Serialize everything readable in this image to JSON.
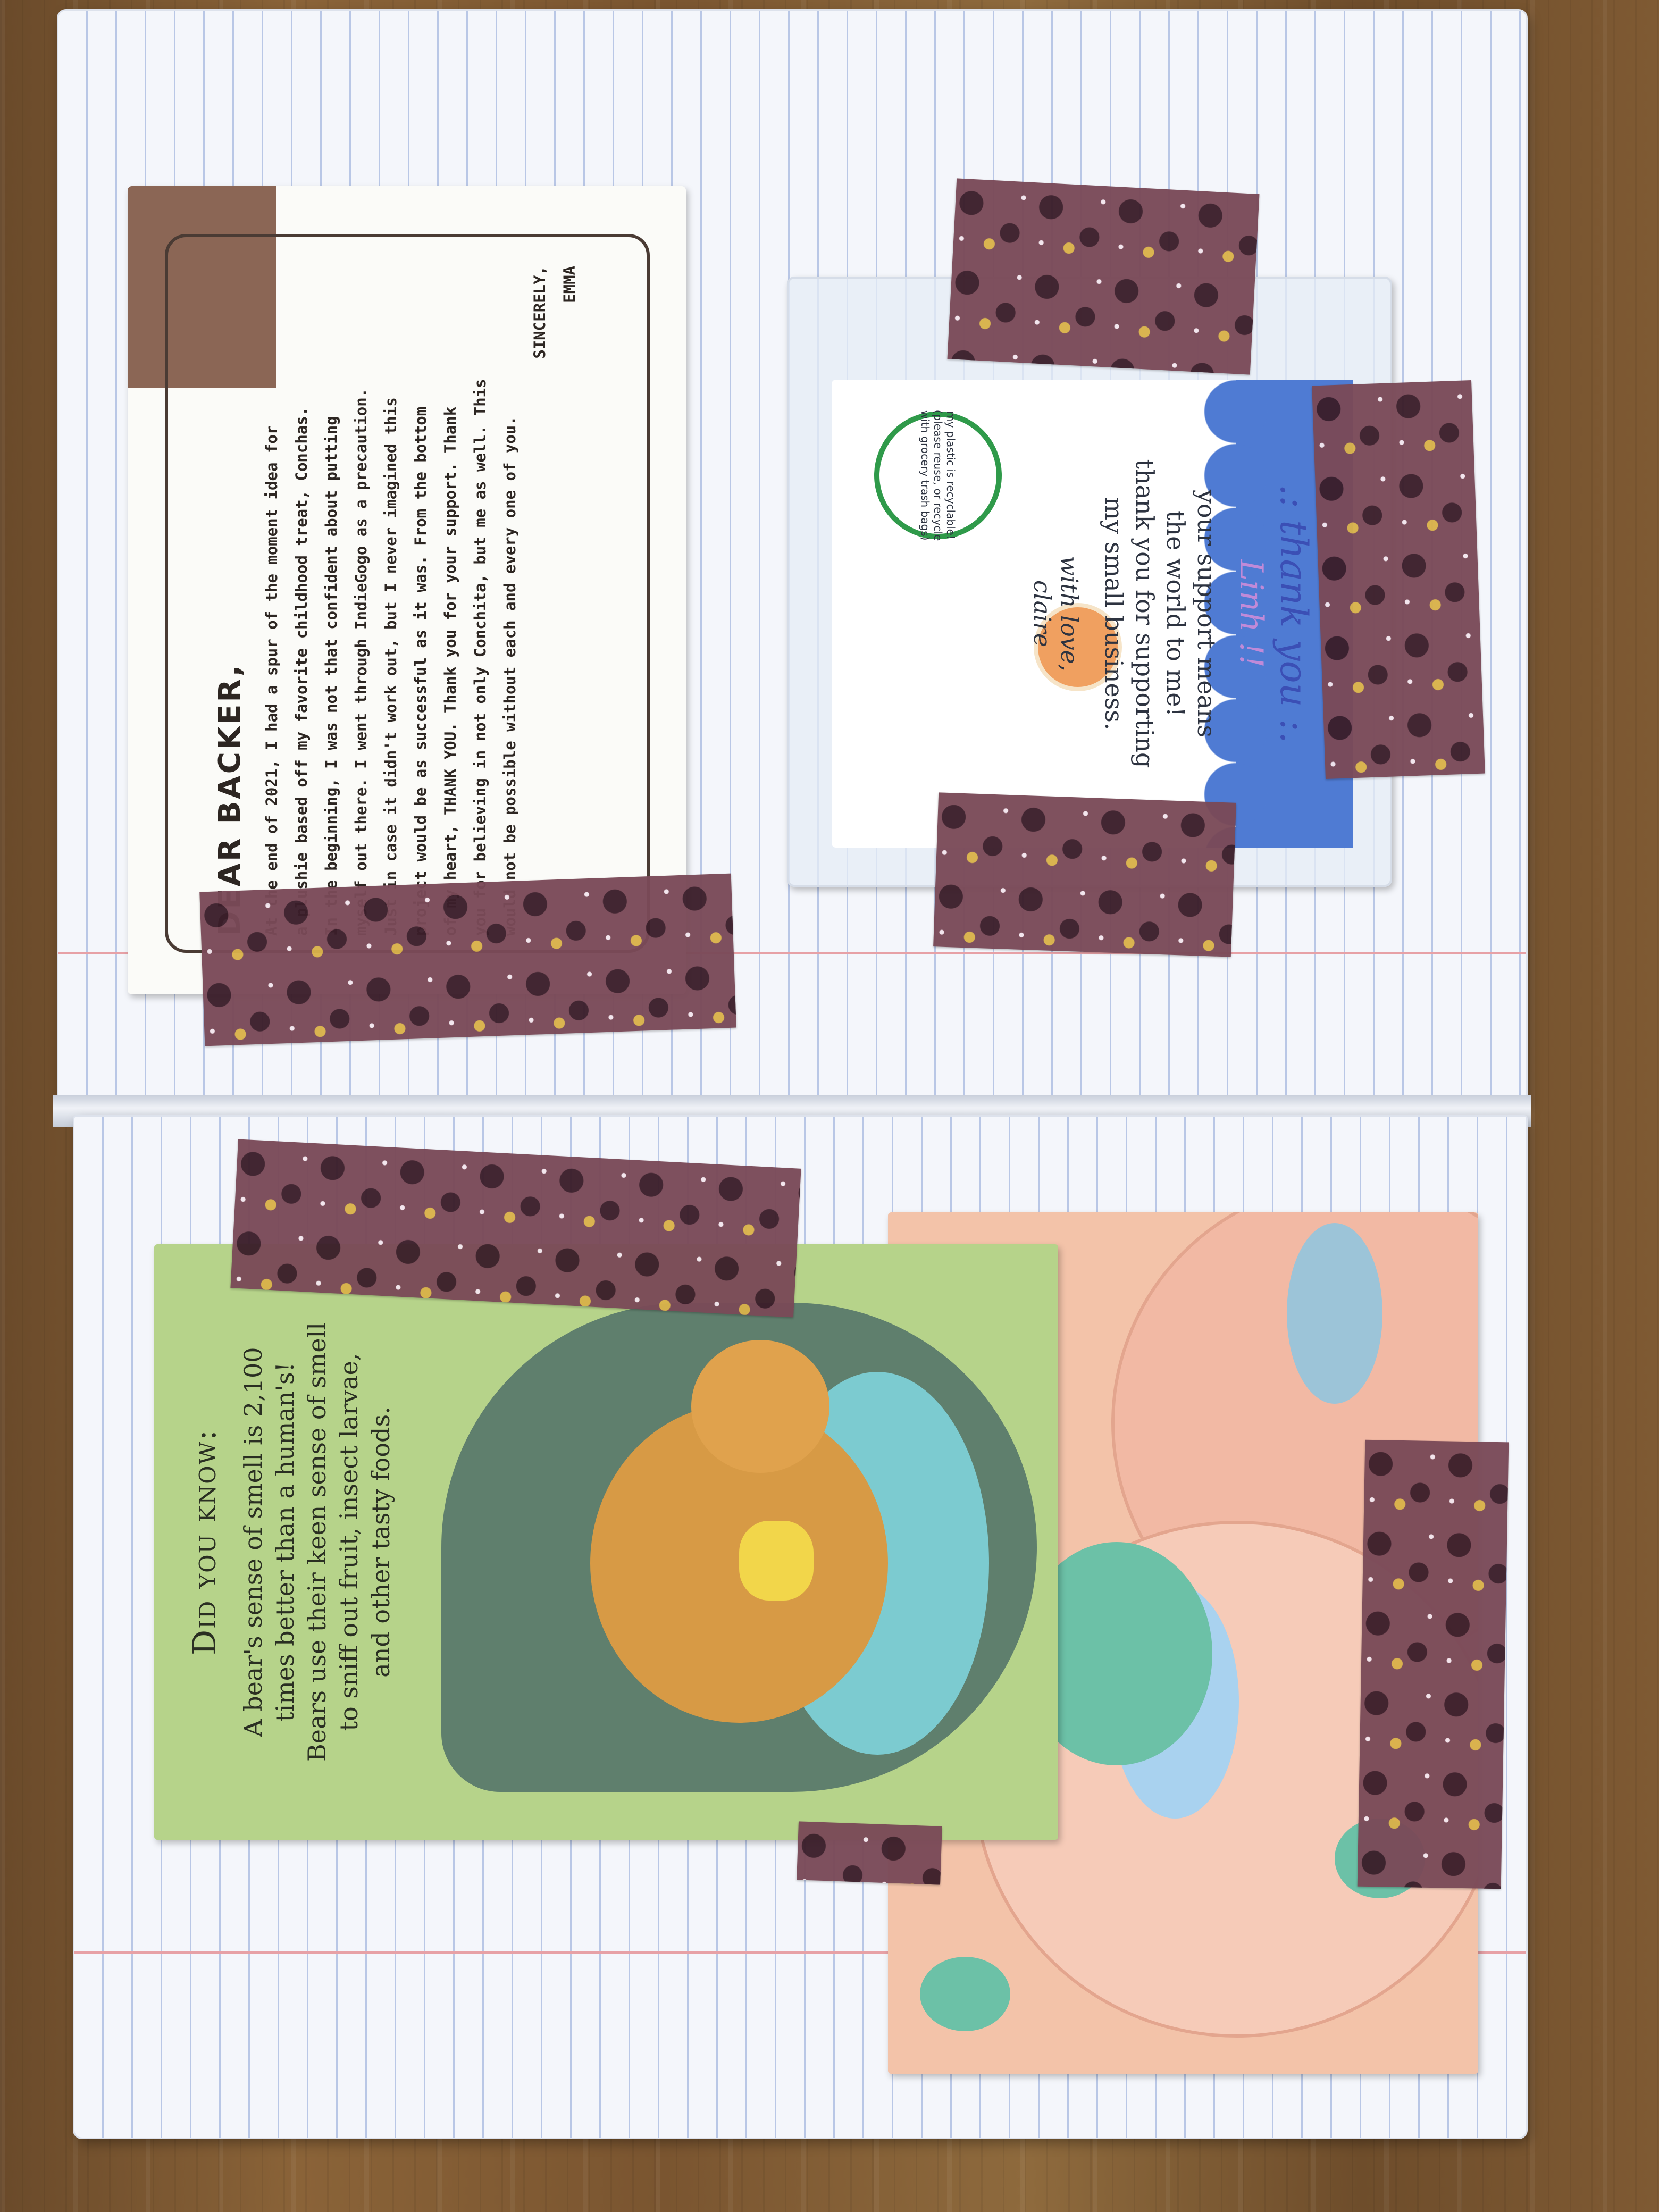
{
  "letter": {
    "greeting": "DEAR BACKER,",
    "body_lines": [
      "At the end of 2021, I had a spur of the moment idea for",
      "a plushie based off my favorite childhood treat, Conchas.",
      "In the beginning, I was not that confident about putting",
      "myself out there. I went through IndieGogo as a precaution.",
      "Just in case it didn't work out, but I never imagined this",
      "project would be as successful as it was. From the bottom",
      "of my heart, THANK YOU. Thank you for your support. Thank",
      "you for believing in not only Conchita, but me as well. This",
      "would not be possible without each and every one of you."
    ],
    "closing": "SINCERELY,",
    "signature": "EMMA"
  },
  "thank_you_card": {
    "title": ".: thank you :.",
    "name": "Linh !!",
    "message_lines": [
      "your support means",
      "the world to me!",
      "thank you for supporting",
      "my small business."
    ],
    "signoff": "with love,",
    "signature": "claire",
    "recycle_text": "my plastic is recyclable! (please reuse, or recycle with grocery trash bags)"
  },
  "bear_card": {
    "heading": "Did you know:",
    "fact_lines": [
      "A bear's sense of smell is 2,100",
      "times better than a human's!",
      "Bears use their keen sense of smell",
      "to sniff out fruit, insect larvae,",
      "and other tasty foods."
    ]
  },
  "colors": {
    "washi_tape": "#7a4a58",
    "bear_card_bg": "#b6d38a",
    "thank_you_accent": "#4f7bd3",
    "postcard_bg": "#f3c3a9",
    "wood": "#7a5530"
  }
}
